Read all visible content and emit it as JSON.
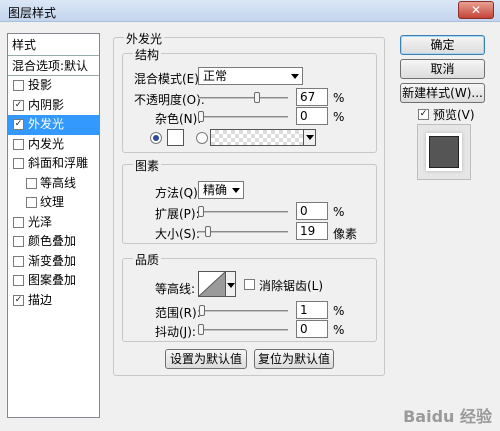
{
  "window": {
    "title": "图层样式",
    "close_label": "✕"
  },
  "left_panel": {
    "header": "样式",
    "blend_options": "混合选项:默认",
    "items": [
      {
        "label": "投影",
        "checked": false,
        "selected": false,
        "sub": false
      },
      {
        "label": "内阴影",
        "checked": true,
        "selected": false,
        "sub": false
      },
      {
        "label": "外发光",
        "checked": true,
        "selected": true,
        "sub": false
      },
      {
        "label": "内发光",
        "checked": false,
        "selected": false,
        "sub": false
      },
      {
        "label": "斜面和浮雕",
        "checked": false,
        "selected": false,
        "sub": false
      },
      {
        "label": "等高线",
        "checked": false,
        "selected": false,
        "sub": true
      },
      {
        "label": "纹理",
        "checked": false,
        "selected": false,
        "sub": true
      },
      {
        "label": "光泽",
        "checked": false,
        "selected": false,
        "sub": false
      },
      {
        "label": "颜色叠加",
        "checked": false,
        "selected": false,
        "sub": false
      },
      {
        "label": "渐变叠加",
        "checked": false,
        "selected": false,
        "sub": false
      },
      {
        "label": "图案叠加",
        "checked": false,
        "selected": false,
        "sub": false
      },
      {
        "label": "描边",
        "checked": true,
        "selected": false,
        "sub": false
      }
    ]
  },
  "main": {
    "section_title": "外发光",
    "structure": {
      "title": "结构",
      "blend_mode_label": "混合模式(E):",
      "blend_mode_value": "正常",
      "opacity_label": "不透明度(O):",
      "opacity_value": "67",
      "opacity_unit": "%",
      "opacity_fraction": 0.67,
      "noise_label": "杂色(N):",
      "noise_value": "0",
      "noise_unit": "%",
      "noise_fraction": 0.0
    },
    "elements": {
      "title": "图素",
      "method_label": "方法(Q):",
      "method_value": "精确",
      "spread_label": "扩展(P):",
      "spread_value": "0",
      "spread_unit": "%",
      "spread_fraction": 0.0,
      "size_label": "大小(S):",
      "size_value": "19",
      "size_unit": "像素",
      "size_fraction": 0.08
    },
    "quality": {
      "title": "品质",
      "contour_label": "等高线:",
      "antialias_label": "消除锯齿(L)",
      "range_label": "范围(R):",
      "range_value": "1",
      "range_unit": "%",
      "range_fraction": 0.01,
      "jitter_label": "抖动(J):",
      "jitter_value": "0",
      "jitter_unit": "%",
      "jitter_fraction": 0.0
    },
    "set_default_label": "设置为默认值",
    "reset_default_label": "复位为默认值"
  },
  "right": {
    "ok_label": "确定",
    "cancel_label": "取消",
    "new_style_label": "新建样式(W)...",
    "preview_label": "预览(V)",
    "preview_checked": true
  },
  "watermark": "Baidu 经验"
}
